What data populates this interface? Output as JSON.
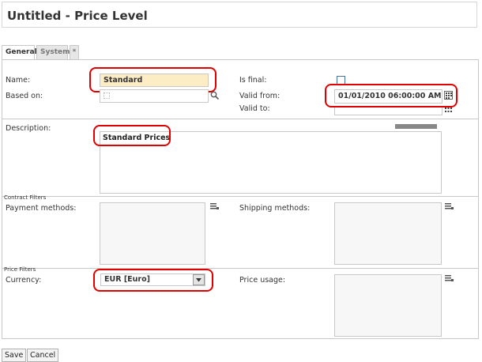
{
  "window": {
    "title": "Untitled - Price Level"
  },
  "tabs": [
    {
      "label": "General",
      "active": true
    },
    {
      "label": "System",
      "active": false
    },
    {
      "label": "*",
      "active": false
    }
  ],
  "form": {
    "name_label": "Name:",
    "name_value": "Standard",
    "based_on_label": "Based on:",
    "based_on_value": "",
    "is_final_label": "Is final:",
    "is_final_checked": false,
    "valid_from_label": "Valid from:",
    "valid_from_value": "01/01/2010 06:00:00 AM",
    "valid_to_label": "Valid to:",
    "valid_to_value": "",
    "description_label": "Description:",
    "description_value": "Standard Prices"
  },
  "contract_filters": {
    "section_label": "Contract Filters",
    "payment_label": "Payment methods:",
    "shipping_label": "Shipping methods:"
  },
  "price_filters": {
    "section_label": "Price Filters",
    "currency_label": "Currency:",
    "currency_value": "EUR [Euro]",
    "price_usage_label": "Price usage:"
  },
  "buttons": {
    "save": "Save",
    "cancel": "Cancel"
  },
  "colors": {
    "highlight_ring": "#e00000",
    "name_field_bg": "#fdedc4",
    "border": "#c8c8c8"
  },
  "icons": [
    "search-icon",
    "calendar-icon",
    "list-icon",
    "dropdown-arrow-icon"
  ]
}
